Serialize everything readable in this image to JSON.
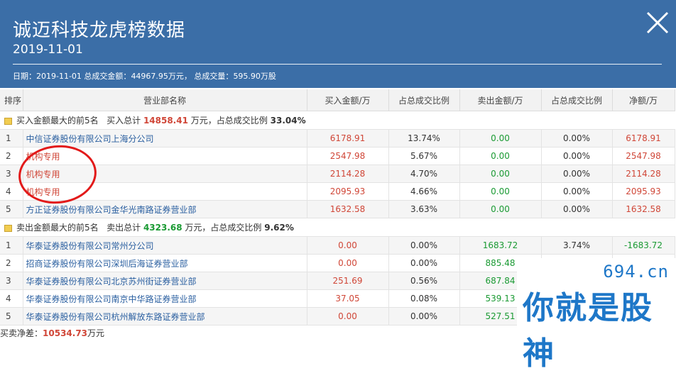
{
  "header": {
    "title": "诚迈科技龙虎榜数据",
    "date": "2019-11-01",
    "summary": {
      "date_prefix": "日期：",
      "date": "2019-11-01",
      "volume_label": " 总成交金额：",
      "volume": "44967.95万元",
      "qty_label": "， 总成交量：",
      "qty": "595.90万股"
    }
  },
  "columns": [
    "排序",
    "营业部名称",
    "买入金额/万",
    "占总成交比例",
    "卖出金额/万",
    "占总成交比例",
    "净额/万"
  ],
  "buy_section": {
    "label": "买入金额最大的前5名",
    "total_label": "买入总计",
    "total": "14858.41",
    "unit_text": "万元，占总成交比例",
    "ratio": "33.04%",
    "rows": [
      {
        "rank": "1",
        "name": "中信证券股份有限公司上海分公司",
        "buy": "6178.91",
        "buy_pct": "13.74%",
        "sell": "0.00",
        "sell_pct": "0.00%",
        "net": "6178.91"
      },
      {
        "rank": "2",
        "name": "机构专用",
        "buy": "2547.98",
        "buy_pct": "5.67%",
        "sell": "0.00",
        "sell_pct": "0.00%",
        "net": "2547.98"
      },
      {
        "rank": "3",
        "name": "机构专用",
        "buy": "2114.28",
        "buy_pct": "4.70%",
        "sell": "0.00",
        "sell_pct": "0.00%",
        "net": "2114.28"
      },
      {
        "rank": "4",
        "name": "机构专用",
        "buy": "2095.93",
        "buy_pct": "4.66%",
        "sell": "0.00",
        "sell_pct": "0.00%",
        "net": "2095.93"
      },
      {
        "rank": "5",
        "name": "方正证券股份有限公司金华光南路证券营业部",
        "buy": "1632.58",
        "buy_pct": "3.63%",
        "sell": "0.00",
        "sell_pct": "0.00%",
        "net": "1632.58"
      }
    ]
  },
  "sell_section": {
    "label": "卖出金额最大的前5名",
    "total_label": "卖出总计",
    "total": "4323.68",
    "unit_text": "万元，占总成交比例",
    "ratio": "9.62%",
    "rows": [
      {
        "rank": "1",
        "name": "华泰证券股份有限公司常州分公司",
        "buy": "0.00",
        "buy_pct": "0.00%",
        "sell": "1683.72",
        "sell_pct": "3.74%",
        "net": "-1683.72"
      },
      {
        "rank": "2",
        "name": "招商证券股份有限公司深圳后海证券营业部",
        "buy": "0.00",
        "buy_pct": "0.00%",
        "sell": "885.48",
        "sell_pct": "",
        "net": ""
      },
      {
        "rank": "3",
        "name": "华泰证券股份有限公司北京苏州街证券营业部",
        "buy": "251.69",
        "buy_pct": "0.56%",
        "sell": "687.84",
        "sell_pct": "",
        "net": ""
      },
      {
        "rank": "4",
        "name": "华泰证券股份有限公司南京中华路证券营业部",
        "buy": "37.05",
        "buy_pct": "0.08%",
        "sell": "539.13",
        "sell_pct": "",
        "net": ""
      },
      {
        "rank": "5",
        "name": "华泰证券股份有限公司杭州解放东路证券营业部",
        "buy": "0.00",
        "buy_pct": "0.00%",
        "sell": "527.51",
        "sell_pct": "",
        "net": ""
      }
    ]
  },
  "footer": {
    "net_label": "买卖净差：",
    "net_value": "10534.73",
    "net_unit": "万元"
  },
  "watermark": {
    "domain": "694.cn",
    "slogan": "你就是股神"
  },
  "colors": {
    "header_bg": "#3b6ea7",
    "red": "#d04637",
    "green": "#1a9a33",
    "link": "#2a5fa0",
    "annotation": "#e21919",
    "watermark": "#1e77c8"
  },
  "icons": {
    "close": "close-icon",
    "section": "folder-icon"
  }
}
